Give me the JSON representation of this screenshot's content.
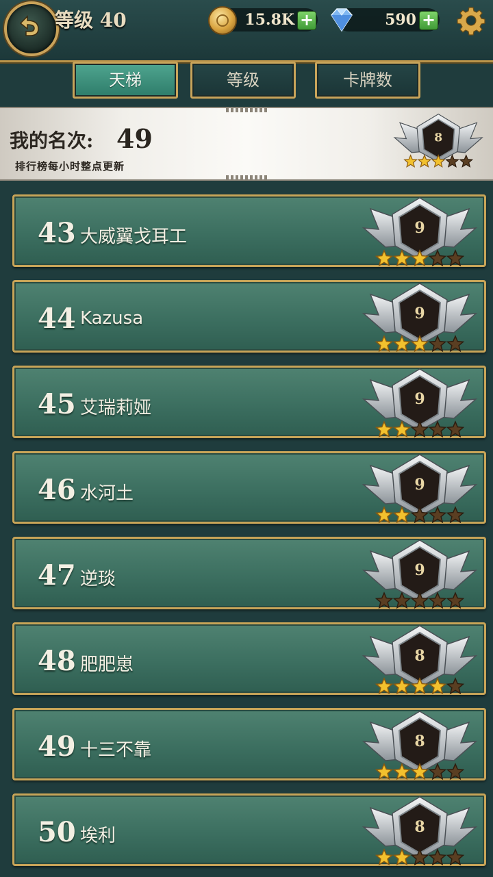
{
  "header": {
    "level_label": "等级 40",
    "gold": "15.8K",
    "gems": "590",
    "plus_label": "+"
  },
  "tabs": [
    {
      "label": "天梯",
      "active": true
    },
    {
      "label": "等级",
      "active": false
    },
    {
      "label": "卡牌数",
      "active": false
    }
  ],
  "my_rank": {
    "label": "我的名次:",
    "value": "49",
    "note": "排行榜每小时整点更新",
    "badge_level": "8",
    "stars_filled": 3,
    "stars_total": 5
  },
  "leaderboard": [
    {
      "rank": "43",
      "name": "大威翼戈耳工",
      "badge_level": "9",
      "stars_filled": 3
    },
    {
      "rank": "44",
      "name": "Kazusa",
      "badge_level": "9",
      "stars_filled": 3
    },
    {
      "rank": "45",
      "name": "艾瑞莉娅",
      "badge_level": "9",
      "stars_filled": 2
    },
    {
      "rank": "46",
      "name": "水河土",
      "badge_level": "9",
      "stars_filled": 2
    },
    {
      "rank": "47",
      "name": "逆琰",
      "badge_level": "9",
      "stars_filled": 0
    },
    {
      "rank": "48",
      "name": "肥肥崽",
      "badge_level": "8",
      "stars_filled": 4
    },
    {
      "rank": "49",
      "name": "十三不靠",
      "badge_level": "8",
      "stars_filled": 3
    },
    {
      "rank": "50",
      "name": "埃利",
      "badge_level": "8",
      "stars_filled": 2
    }
  ],
  "colors": {
    "star_filled": "#f2c12e",
    "star_empty": "#5a3e22",
    "row_border": "#c7a458",
    "tab_active": "#3f927d"
  },
  "icons": {
    "back": "back-arrow-icon",
    "gold": "gold-coin-icon",
    "gem": "diamond-icon",
    "settings": "gear-icon",
    "badge": "rank-badge-icon",
    "star": "star-icon"
  }
}
